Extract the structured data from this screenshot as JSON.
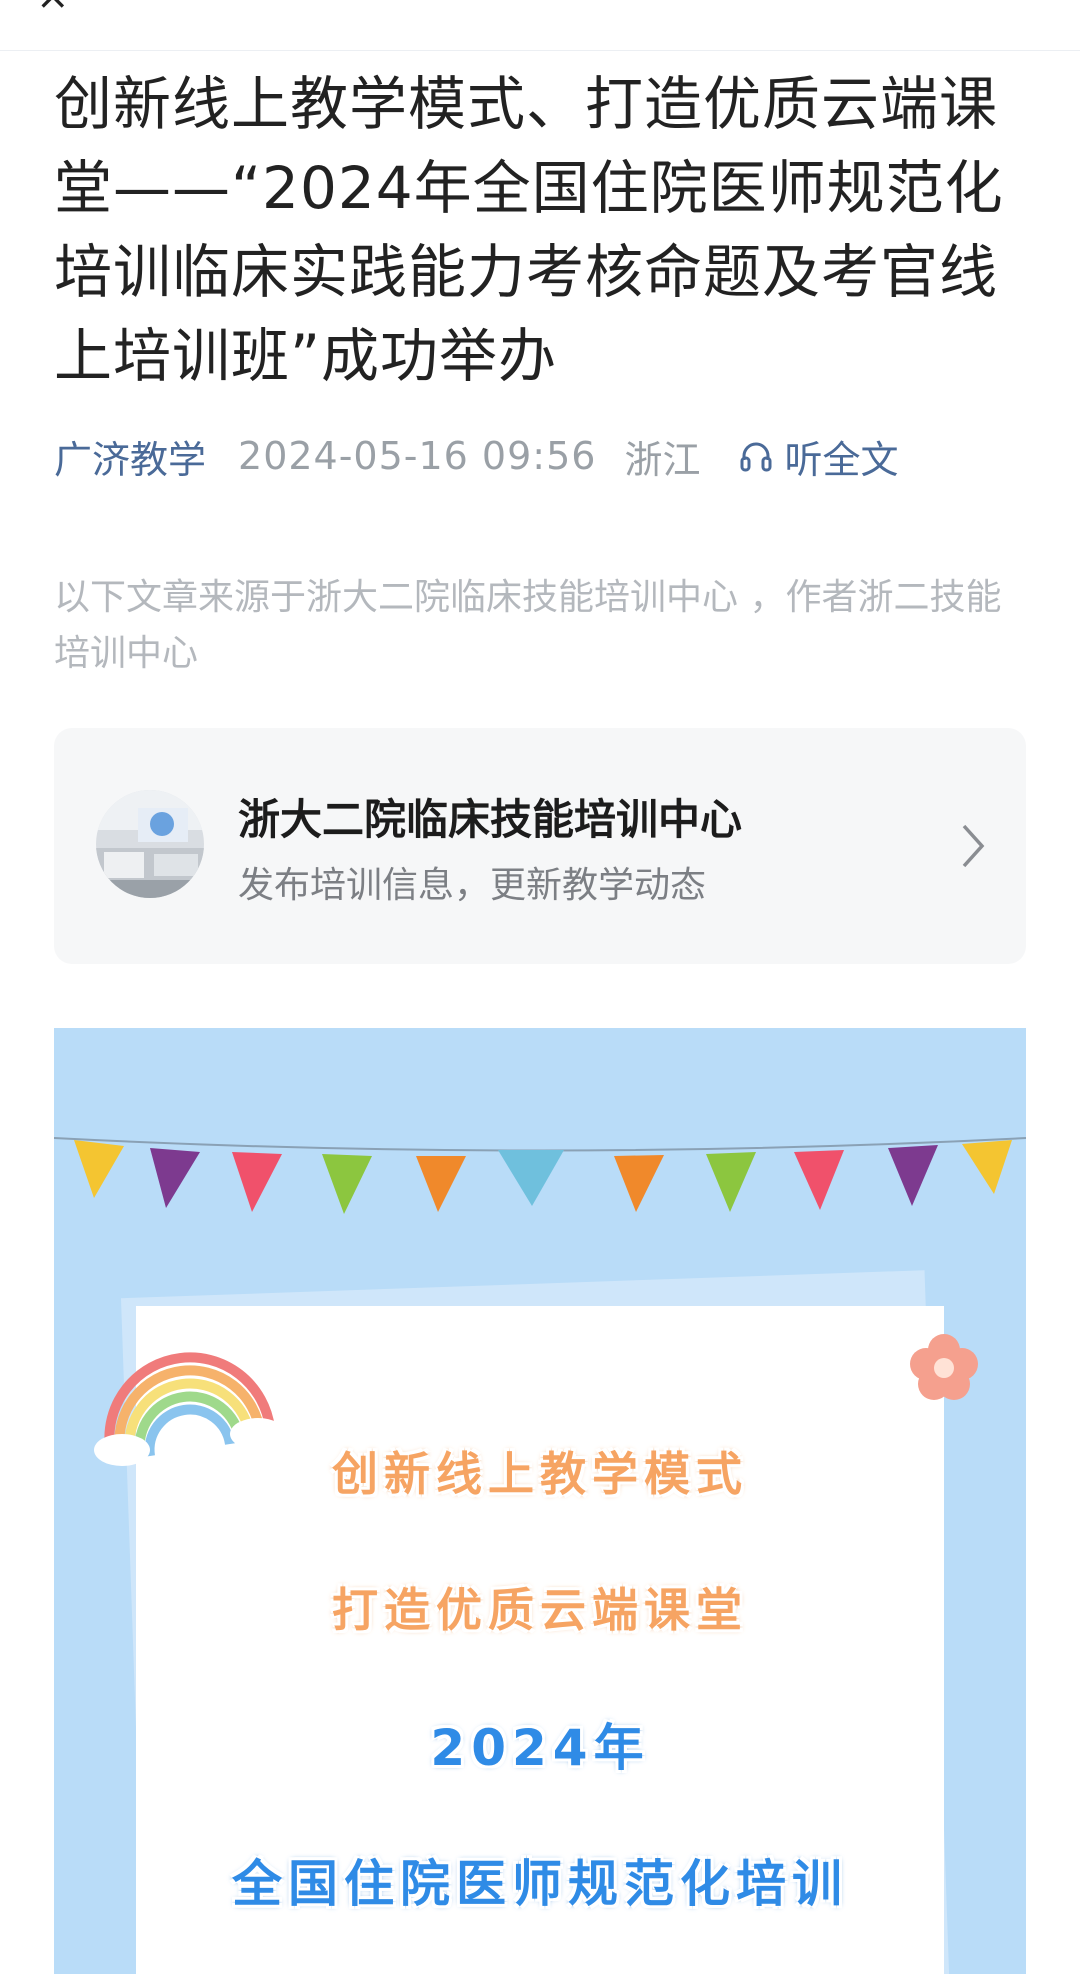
{
  "header": {
    "close_glyph": "×"
  },
  "article": {
    "title": "创新线上教学模式、打造优质云端课堂——“2024年全国住院医师规范化培训临床实践能力考核命题及考官线上培训班”成功举办",
    "account": "广济教学",
    "date": "2024-05-16 09:56",
    "region": "浙江",
    "listen_label": "听全文",
    "source_note": "以下文章来源于浙大二院临床技能培训中心 ，作者浙二技能培训中心"
  },
  "source_card": {
    "name": "浙大二院临床技能培训中心",
    "description": "发布培训信息，更新教学动态"
  },
  "poster": {
    "line1": "创新线上教学模式",
    "line2": "打造优质云端课堂",
    "line3": "2024年",
    "line4": "全国住院医师规范化培训"
  },
  "colors": {
    "link_blue": "#4a6a98",
    "poster_bg": "#b9dcf8",
    "poster_orange": "#f6a463",
    "poster_blue": "#2f8be6"
  },
  "icons": [
    "close-icon",
    "headphones-icon",
    "chevron-right-icon",
    "avatar-photo",
    "bunting-flags",
    "rainbow-decoration",
    "flower-decoration"
  ]
}
